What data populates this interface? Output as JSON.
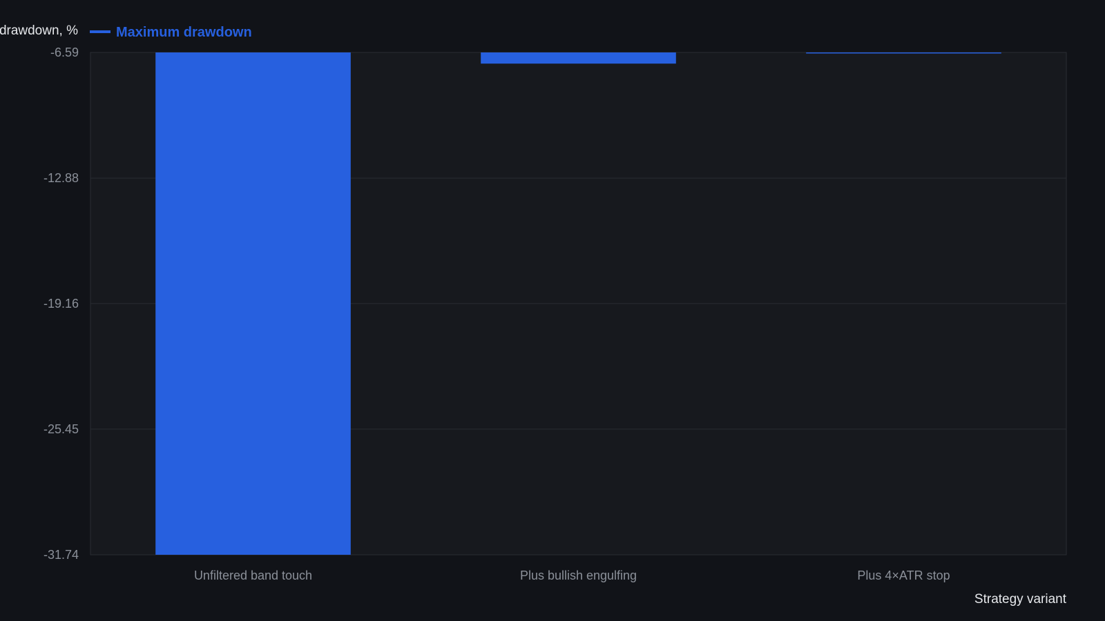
{
  "chart_data": {
    "type": "bar",
    "categories": [
      "Unfiltered band touch",
      "Plus bullish engulfing",
      "Plus 4×ATR stop"
    ],
    "series": [
      {
        "name": "Maximum drawdown",
        "values": [
          -31.74,
          -7.15,
          -6.63
        ]
      }
    ],
    "xlabel": "Strategy variant",
    "ylabel": "drawdown, %",
    "ylim": [
      -31.74,
      -6.59
    ],
    "yticks": [
      -6.59,
      -12.88,
      -19.16,
      -25.45,
      -31.74
    ],
    "ytick_labels": [
      "-6.59",
      "-12.88",
      "-19.16",
      "-25.45",
      "-31.74"
    ],
    "grid": true,
    "legend_position": "top-left",
    "colors": {
      "background": "#111318",
      "plot_background": "#17191e",
      "bar": "#2760df",
      "grid": "#2a2d33",
      "tick_text": "#8b9099",
      "title_text": "#e6e8eb"
    }
  }
}
